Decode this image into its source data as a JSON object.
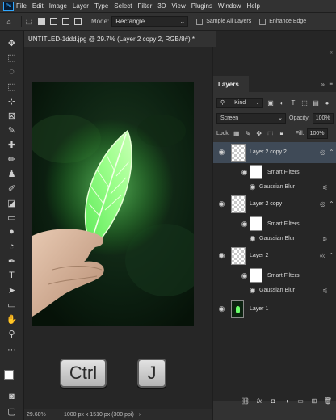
{
  "menubar": {
    "logo": "Ps",
    "items": [
      "File",
      "Edit",
      "Image",
      "Layer",
      "Type",
      "Select",
      "Filter",
      "3D",
      "View",
      "Plugins",
      "Window",
      "Help"
    ]
  },
  "options": {
    "mode_label": "Mode:",
    "mode_value": "Rectangle",
    "sample_all_layers": "Sample All Layers",
    "enhance_edge": "Enhance Edge"
  },
  "document": {
    "tab_title": "UNTITLED-1ddd.jpg @ 29.7% (Layer 2 copy 2, RGB/8#) *",
    "zoom": "29.68%",
    "info": "1000 px x 1510 px (300 ppi)"
  },
  "shortcut": {
    "key1": "Ctrl",
    "plus": "+",
    "key2": "J"
  },
  "layers_panel": {
    "title": "Layers",
    "filter_kind": "Kind",
    "blend_mode": "Screen",
    "opacity_label": "Opacity:",
    "opacity_value": "100%",
    "lock_label": "Lock:",
    "fill_label": "Fill:",
    "fill_value": "100%",
    "layers": [
      {
        "name": "Layer 2 copy 2",
        "smart_filters": "Smart Filters",
        "filter": "Gaussian Blur",
        "selected": true
      },
      {
        "name": "Layer 2 copy",
        "smart_filters": "Smart Filters",
        "filter": "Gaussian Blur",
        "selected": false
      },
      {
        "name": "Layer 2",
        "smart_filters": "Smart Filters",
        "filter": "Gaussian Blur",
        "selected": false
      },
      {
        "name": "Layer 1",
        "selected": false
      }
    ],
    "footer_icons": [
      "link-icon",
      "fx-icon",
      "mask-icon",
      "adjustment-icon",
      "group-icon",
      "new-layer-icon",
      "trash-icon"
    ]
  },
  "colors": {
    "selection": "#3f4a57",
    "accent": "#31a8ff"
  }
}
